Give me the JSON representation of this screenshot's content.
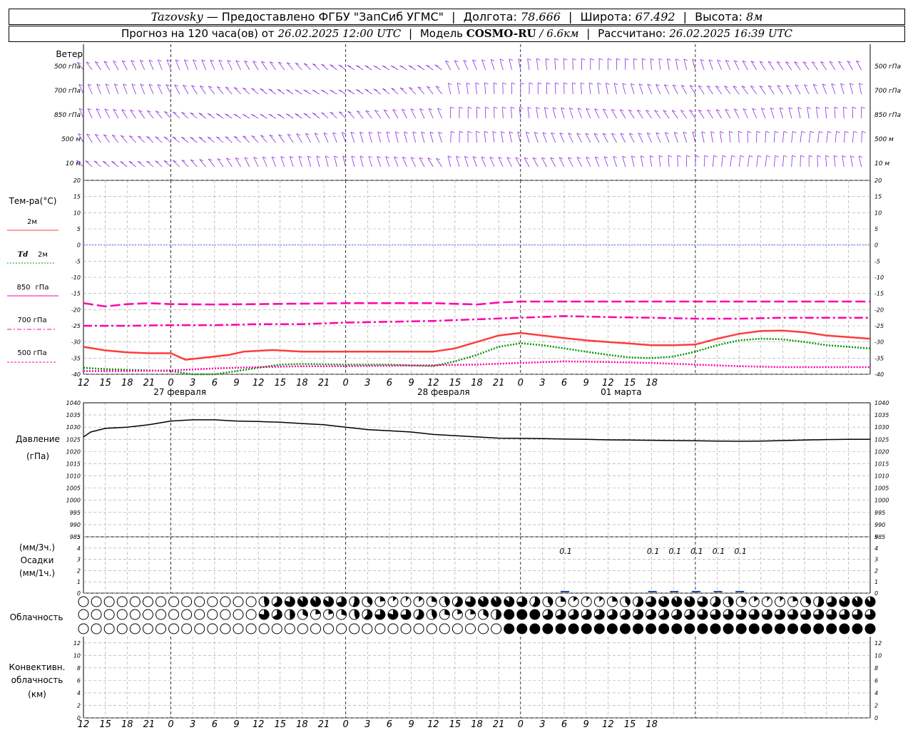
{
  "header": {
    "station": "Tazovsky",
    "provider": "Предоставлено ФГБУ \"ЗапСиб УГМС\"",
    "lon_label": "Долгота:",
    "lon_value": "78.666",
    "lat_label": "Широта:",
    "lat_value": "67.492",
    "alt_label": "Высота:",
    "alt_value": "8м",
    "forecast_label": "Прогноз на 120 часа(ов) от",
    "forecast_time": "26.02.2025 12:00 UTC",
    "model_label": "Модель",
    "model_name": "COSMO-RU",
    "model_res": "/ 6.6км",
    "calc_label": "Рассчитано:",
    "calc_time": "26.02.2025 16:39 UTC"
  },
  "labels": {
    "wind_title": "Ветер",
    "wind_levels": [
      "500 гПа",
      "700 гПа",
      "850 гПа",
      "500 м",
      "10  м"
    ],
    "temp_title": "Тем-ра(°С)",
    "legend_t2m": "2м",
    "legend_td": "Td",
    "legend_td_unit": "2м",
    "legend_850": "850",
    "legend_700": "700 гПа",
    "legend_500": "500 гПа",
    "legend_hpa": "гПа",
    "pressure_title": "Давление",
    "pressure_unit": "(гПа)",
    "precip_unit3": "(мм/3ч.)",
    "precip_title": "Осадки",
    "precip_unit1": "(мм/1ч.)",
    "cloud_title": "Облачность",
    "conv_title1": "Конвективн.",
    "conv_title2": "облачность",
    "conv_unit": "(км)"
  },
  "chart_data": [
    {
      "type": "line",
      "title": "Тем-ра(°С)",
      "x_unit": "hours from 26.02.2025 12:00 UTC",
      "x_tick_labels": [
        "12",
        "15",
        "18",
        "21",
        "0",
        "3",
        "6",
        "9",
        "12",
        "15",
        "18",
        "21",
        "0",
        "3",
        "6",
        "9",
        "12",
        "15",
        "18",
        "21",
        "0",
        "3",
        "6",
        "9",
        "12",
        "15",
        "18"
      ],
      "date_labels": [
        "27 февраля",
        "28 февраля",
        "01 марта"
      ],
      "ylim": [
        -40,
        20
      ],
      "y_ticks": [
        20,
        15,
        10,
        5,
        0,
        -5,
        -10,
        -15,
        -20,
        -25,
        -30,
        -35,
        -40
      ],
      "series": [
        {
          "name": "2м",
          "color": "#ff3c3c",
          "style": "solid",
          "points": [
            [
              0,
              -31.5
            ],
            [
              3,
              -32.6
            ],
            [
              6,
              -33.2
            ],
            [
              9,
              -33.5
            ],
            [
              12,
              -33.5
            ],
            [
              14,
              -35.5
            ],
            [
              18,
              -34.5
            ],
            [
              20,
              -34
            ],
            [
              22,
              -33
            ],
            [
              26,
              -32.5
            ],
            [
              30,
              -33
            ],
            [
              36,
              -33
            ],
            [
              42,
              -33
            ],
            [
              48,
              -33
            ],
            [
              51,
              -32
            ],
            [
              54,
              -30
            ],
            [
              57,
              -28
            ],
            [
              60,
              -27.2
            ],
            [
              63,
              -28
            ],
            [
              66,
              -28.8
            ],
            [
              69,
              -29.5
            ],
            [
              72,
              -30
            ],
            [
              75,
              -30.5
            ],
            [
              78,
              -31
            ],
            [
              81,
              -31
            ],
            [
              84,
              -30.8
            ],
            [
              87,
              -29
            ],
            [
              90,
              -27.5
            ],
            [
              93,
              -26.6
            ],
            [
              96,
              -26.5
            ],
            [
              99,
              -27
            ],
            [
              102,
              -28
            ],
            [
              105,
              -28.5
            ],
            [
              108,
              -29
            ]
          ]
        },
        {
          "name": "Td 2м",
          "color": "#009900",
          "style": "dotted",
          "points": [
            [
              0,
              -38
            ],
            [
              3,
              -38.4
            ],
            [
              6,
              -38.6
            ],
            [
              9,
              -38.8
            ],
            [
              12,
              -39
            ],
            [
              15,
              -40
            ],
            [
              18,
              -40
            ],
            [
              21,
              -39
            ],
            [
              24,
              -38
            ],
            [
              27,
              -37
            ],
            [
              30,
              -36.8
            ],
            [
              36,
              -37
            ],
            [
              42,
              -37
            ],
            [
              48,
              -37.5
            ],
            [
              51,
              -36
            ],
            [
              54,
              -34
            ],
            [
              57,
              -31.5
            ],
            [
              60,
              -30.4
            ],
            [
              63,
              -31
            ],
            [
              66,
              -32
            ],
            [
              69,
              -33
            ],
            [
              72,
              -34
            ],
            [
              75,
              -34.8
            ],
            [
              78,
              -35
            ],
            [
              81,
              -34.5
            ],
            [
              84,
              -33
            ],
            [
              87,
              -31
            ],
            [
              90,
              -29.5
            ],
            [
              93,
              -29
            ],
            [
              96,
              -29.2
            ],
            [
              99,
              -30
            ],
            [
              102,
              -31
            ],
            [
              105,
              -31.5
            ],
            [
              108,
              -32
            ]
          ]
        },
        {
          "name": "850 гПа",
          "color": "#ff00aa",
          "style": "longdash",
          "points": [
            [
              0,
              -18
            ],
            [
              3,
              -19
            ],
            [
              6,
              -18.3
            ],
            [
              9,
              -18
            ],
            [
              12,
              -18.3
            ],
            [
              18,
              -18.4
            ],
            [
              24,
              -18.3
            ],
            [
              36,
              -18
            ],
            [
              48,
              -18
            ],
            [
              54,
              -18.4
            ],
            [
              57,
              -17.8
            ],
            [
              60,
              -17.5
            ],
            [
              72,
              -17.5
            ],
            [
              84,
              -17.5
            ],
            [
              96,
              -17.5
            ],
            [
              108,
              -17.5
            ]
          ]
        },
        {
          "name": "700 гПа",
          "color": "#ff00aa",
          "style": "dashdot",
          "points": [
            [
              0,
              -25
            ],
            [
              6,
              -25
            ],
            [
              12,
              -24.8
            ],
            [
              18,
              -24.8
            ],
            [
              24,
              -24.5
            ],
            [
              30,
              -24.5
            ],
            [
              36,
              -24
            ],
            [
              48,
              -23.5
            ],
            [
              54,
              -23
            ],
            [
              60,
              -22.5
            ],
            [
              66,
              -22
            ],
            [
              72,
              -22.3
            ],
            [
              78,
              -22.5
            ],
            [
              84,
              -22.8
            ],
            [
              90,
              -22.8
            ],
            [
              96,
              -22.5
            ],
            [
              108,
              -22.5
            ]
          ]
        },
        {
          "name": "500 гПа",
          "color": "#ff00aa",
          "style": "dotted",
          "points": [
            [
              0,
              -39
            ],
            [
              6,
              -39
            ],
            [
              12,
              -38.8
            ],
            [
              18,
              -38.2
            ],
            [
              24,
              -37.8
            ],
            [
              30,
              -37.5
            ],
            [
              36,
              -37.5
            ],
            [
              48,
              -37.2
            ],
            [
              54,
              -37
            ],
            [
              60,
              -36.5
            ],
            [
              66,
              -36
            ],
            [
              72,
              -36.2
            ],
            [
              78,
              -36.5
            ],
            [
              84,
              -37
            ],
            [
              90,
              -37.5
            ],
            [
              96,
              -37.8
            ],
            [
              108,
              -37.8
            ]
          ]
        }
      ]
    },
    {
      "type": "line",
      "title": "Давление",
      "ylabel": "(гПа)",
      "ylim": [
        985,
        1040
      ],
      "y_ticks": [
        1040,
        1035,
        1030,
        1025,
        1020,
        1015,
        1010,
        1005,
        1000,
        995,
        990,
        985
      ],
      "series": [
        {
          "name": "Давление",
          "color": "#000000",
          "points": [
            [
              0,
              1026
            ],
            [
              1,
              1028
            ],
            [
              3,
              1029.5
            ],
            [
              6,
              1030
            ],
            [
              9,
              1031
            ],
            [
              12,
              1032.5
            ],
            [
              15,
              1033
            ],
            [
              18,
              1033
            ],
            [
              21,
              1032.5
            ],
            [
              24,
              1032.3
            ],
            [
              27,
              1032
            ],
            [
              30,
              1031.5
            ],
            [
              33,
              1031
            ],
            [
              36,
              1030
            ],
            [
              39,
              1029
            ],
            [
              42,
              1028.5
            ],
            [
              45,
              1028
            ],
            [
              48,
              1027
            ],
            [
              51,
              1026.5
            ],
            [
              54,
              1026
            ],
            [
              57,
              1025.5
            ],
            [
              60,
              1025.4
            ],
            [
              63,
              1025.3
            ],
            [
              66,
              1025.1
            ],
            [
              69,
              1025
            ],
            [
              72,
              1024.8
            ],
            [
              75,
              1024.7
            ],
            [
              78,
              1024.6
            ],
            [
              81,
              1024.5
            ],
            [
              84,
              1024.4
            ],
            [
              87,
              1024.3
            ],
            [
              90,
              1024.2
            ],
            [
              93,
              1024.3
            ],
            [
              96,
              1024.5
            ],
            [
              99,
              1024.7
            ],
            [
              102,
              1024.9
            ],
            [
              105,
              1025
            ],
            [
              108,
              1025
            ]
          ]
        }
      ]
    },
    {
      "type": "bar",
      "title": "Осадки",
      "ylim": [
        0,
        5
      ],
      "y_ticks": [
        5,
        4,
        3,
        2,
        1,
        0
      ],
      "values": [
        {
          "x": 66,
          "mm": 0.1,
          "label": "0.1"
        },
        {
          "x": 78,
          "mm": 0.1,
          "label": "0.1"
        },
        {
          "x": 81,
          "mm": 0.1,
          "label": "0.1"
        },
        {
          "x": 84,
          "mm": 0.1,
          "label": "0.1"
        },
        {
          "x": 87,
          "mm": 0.1,
          "label": "0.1"
        },
        {
          "x": 90,
          "mm": 0.1,
          "label": "0.1"
        }
      ]
    },
    {
      "type": "line",
      "title": "Конвективн. облачность",
      "ylabel": "(км)",
      "ylim": [
        0,
        13
      ],
      "y_ticks": [
        12,
        10,
        8,
        6,
        4,
        2,
        0
      ],
      "series": []
    }
  ],
  "colors": {
    "grid": "#a0a0a0",
    "wind": "#8a2be2",
    "t2m": "#ff3c3c",
    "td": "#009900",
    "upper": "#ff00aa",
    "zero": "#4a6cff",
    "pressure": "#000000",
    "precip": "#2040a0"
  }
}
